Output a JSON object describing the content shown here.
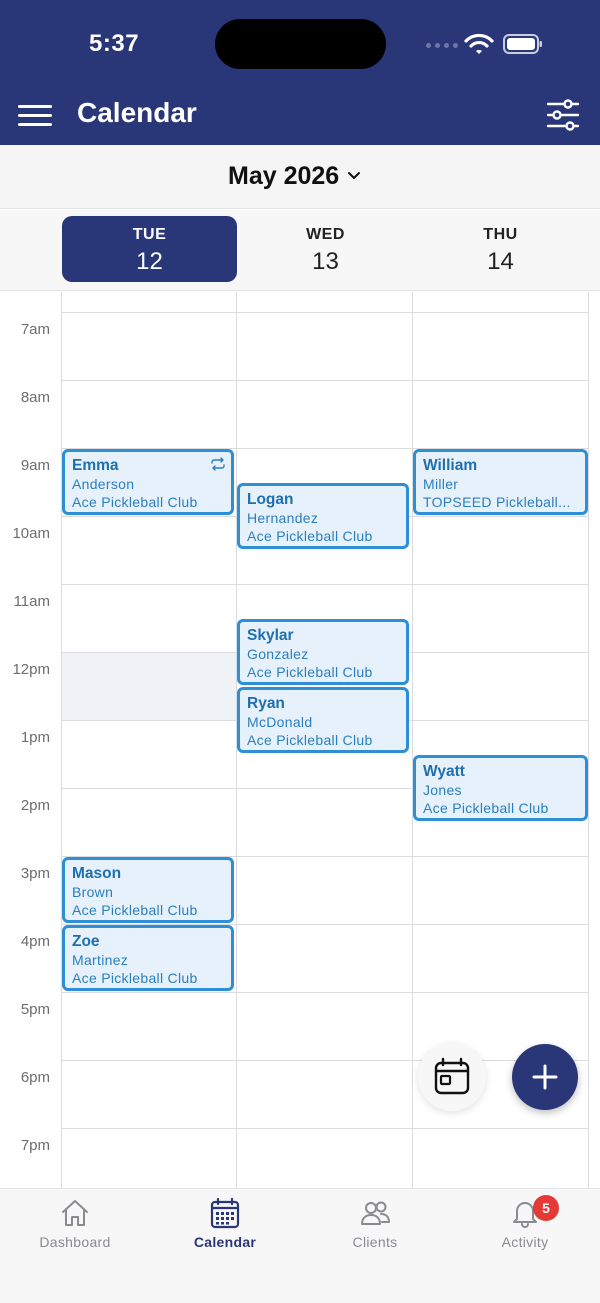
{
  "status_bar": {
    "time": "5:37"
  },
  "header": {
    "title": "Calendar",
    "menu_icon": "hamburger-menu-icon",
    "filter_icon": "sliders-icon",
    "accent": "#293677"
  },
  "month_bar": {
    "label": "May 2026"
  },
  "days": [
    {
      "dow": "TUE",
      "num": "12",
      "selected": true
    },
    {
      "dow": "WED",
      "num": "13",
      "selected": false
    },
    {
      "dow": "THU",
      "num": "14",
      "selected": false
    }
  ],
  "time_labels": [
    "7am",
    "8am",
    "9am",
    "10am",
    "11am",
    "12pm",
    "1pm",
    "2pm",
    "3pm",
    "4pm",
    "5pm",
    "6pm",
    "7pm"
  ],
  "events": [
    {
      "day": "TUE",
      "start": "9am",
      "first": "Emma",
      "last": "Anderson",
      "club": "Ace Pickleball Club",
      "recurring": true
    },
    {
      "day": "WED",
      "start": "9:30am",
      "first": "Logan",
      "last": "Hernandez",
      "club": "Ace Pickleball Club",
      "recurring": false
    },
    {
      "day": "THU",
      "start": "9am",
      "first": "William",
      "last": "Miller",
      "club": "TOPSEED Pickleball...",
      "recurring": false
    },
    {
      "day": "WED",
      "start": "11:30am",
      "first": "Skylar",
      "last": "Gonzalez",
      "club": "Ace Pickleball Club",
      "recurring": false
    },
    {
      "day": "WED",
      "start": "12:30pm",
      "first": "Ryan",
      "last": "McDonald",
      "club": "Ace Pickleball Club",
      "recurring": false
    },
    {
      "day": "THU",
      "start": "1:30pm",
      "first": "Wyatt",
      "last": "Jones",
      "club": "Ace Pickleball Club",
      "recurring": false
    },
    {
      "day": "TUE",
      "start": "3pm",
      "first": "Mason",
      "last": "Brown",
      "club": "Ace Pickleball Club",
      "recurring": false
    },
    {
      "day": "TUE",
      "start": "4pm",
      "first": "Zoe",
      "last": "Martinez",
      "club": "Ace Pickleball Club",
      "recurring": false
    }
  ],
  "fabs": {
    "calendar_icon": "calendar-view-icon",
    "add_icon": "plus-icon"
  },
  "tabs": [
    {
      "label": "Dashboard",
      "icon": "home-icon",
      "active": false
    },
    {
      "label": "Calendar",
      "icon": "calendar-icon",
      "active": true
    },
    {
      "label": "Clients",
      "icon": "users-icon",
      "active": false
    },
    {
      "label": "Activity",
      "icon": "bell-icon",
      "active": false,
      "badge": "5"
    }
  ]
}
